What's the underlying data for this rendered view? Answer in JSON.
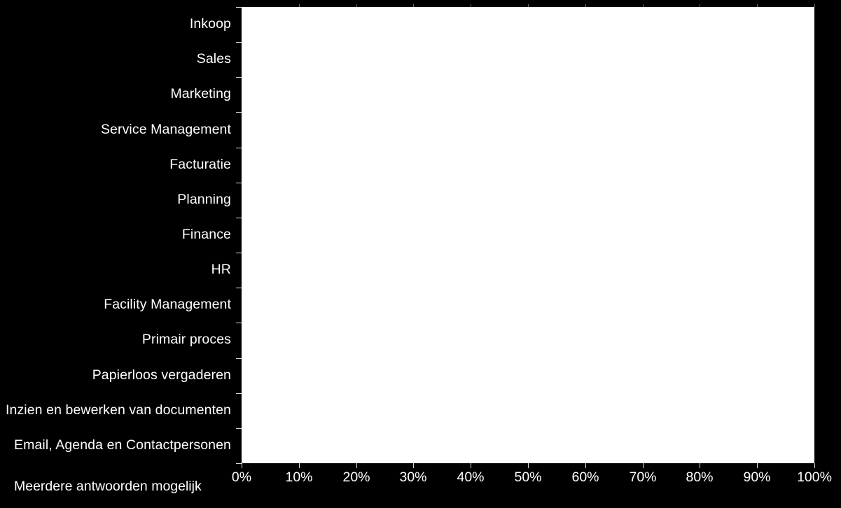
{
  "chart_data": {
    "type": "bar",
    "orientation": "horizontal",
    "title": "",
    "subtitle": "",
    "xlabel": "Meerdere antwoorden mogelijk",
    "ylabel": "",
    "categories": [
      "Inkoop",
      "Sales",
      "Marketing",
      "Service Management",
      "Facturatie",
      "Planning",
      "Finance",
      "HR",
      "Facility Management",
      "Primair proces",
      "Papierloos vergaderen",
      "Inzien en bewerken van documenten",
      "Email, Agenda en Contactpersonen"
    ],
    "values": [
      null,
      null,
      null,
      null,
      null,
      null,
      null,
      null,
      null,
      null,
      null,
      null,
      null
    ],
    "xlim": [
      0,
      100
    ],
    "xticks": [
      0,
      10,
      20,
      30,
      40,
      50,
      60,
      70,
      80,
      90,
      100
    ],
    "xtick_labels": [
      "0%",
      "10%",
      "20%",
      "30%",
      "40%",
      "50%",
      "60%",
      "70%",
      "80%",
      "90%",
      "100%"
    ],
    "grid": false,
    "legend": false,
    "note": "Plot area is empty - no bars rendered"
  },
  "colors": {
    "background": "#000000",
    "plot_background": "#ffffff",
    "text": "#ffffff",
    "tick": "#d9d9d9",
    "tick_top": "#6b6b6b"
  },
  "axis_title": "Meerdere antwoorden mogelijk"
}
